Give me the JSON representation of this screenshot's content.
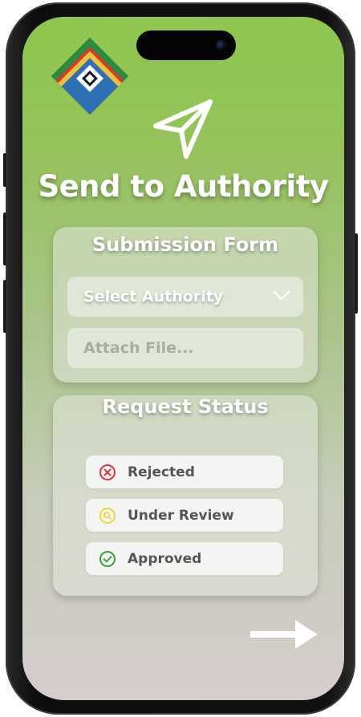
{
  "header": {
    "title": "Send to Authority"
  },
  "submission_form": {
    "title": "Submission Form",
    "select_authority": "Select Authority",
    "attach_file": "Attach File..."
  },
  "request_status": {
    "title": "Request Status",
    "items": [
      {
        "label": "Rejected",
        "icon": "x-circle-icon",
        "color": "#d9363e"
      },
      {
        "label": "Under Review",
        "icon": "search-circle-icon",
        "color": "#f1d640"
      },
      {
        "label": "Approved",
        "icon": "check-circle-icon",
        "color": "#3aa335"
      }
    ]
  },
  "colors": {
    "gradient_top": "#8ec64e",
    "gradient_bottom": "#d6cccc"
  }
}
